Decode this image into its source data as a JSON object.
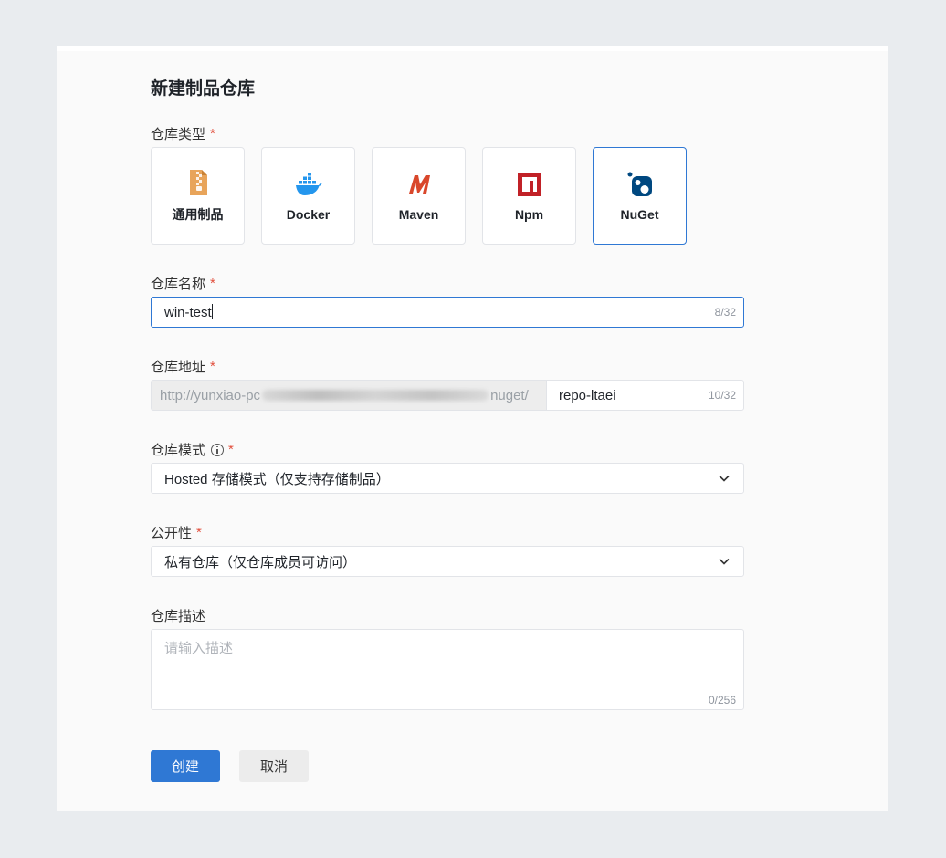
{
  "form": {
    "title": "新建制品仓库",
    "repo_type": {
      "label": "仓库类型",
      "required_mark": "*",
      "options": [
        {
          "label": "通用制品",
          "icon": "generic-artifact-icon",
          "selected": false
        },
        {
          "label": "Docker",
          "icon": "docker-icon",
          "selected": false
        },
        {
          "label": "Maven",
          "icon": "maven-icon",
          "selected": false
        },
        {
          "label": "Npm",
          "icon": "npm-icon",
          "selected": false
        },
        {
          "label": "NuGet",
          "icon": "nuget-icon",
          "selected": true
        }
      ]
    },
    "repo_name": {
      "label": "仓库名称",
      "required_mark": "*",
      "value": "win-test",
      "counter": "8/32"
    },
    "repo_address": {
      "label": "仓库地址",
      "required_mark": "*",
      "prefix_start": "http://yunxiao-pc",
      "prefix_end": "nuget/",
      "value": "repo-ltaei",
      "counter": "10/32"
    },
    "repo_mode": {
      "label": "仓库模式",
      "required_mark": "*",
      "value": "Hosted 存储模式（仅支持存储制品）"
    },
    "visibility": {
      "label": "公开性",
      "required_mark": "*",
      "value": "私有仓库（仅仓库成员可访问）"
    },
    "description": {
      "label": "仓库描述",
      "placeholder": "请输入描述",
      "counter": "0/256"
    },
    "actions": {
      "create_label": "创建",
      "cancel_label": "取消"
    }
  },
  "colors": {
    "accent": "#2f78d4",
    "required": "#e2503e",
    "generic_icon": "#e8a45a",
    "docker_icon": "#2496ed",
    "maven_icon": "#d9472b",
    "npm_icon": "#c12127",
    "nuget_icon": "#004880"
  }
}
